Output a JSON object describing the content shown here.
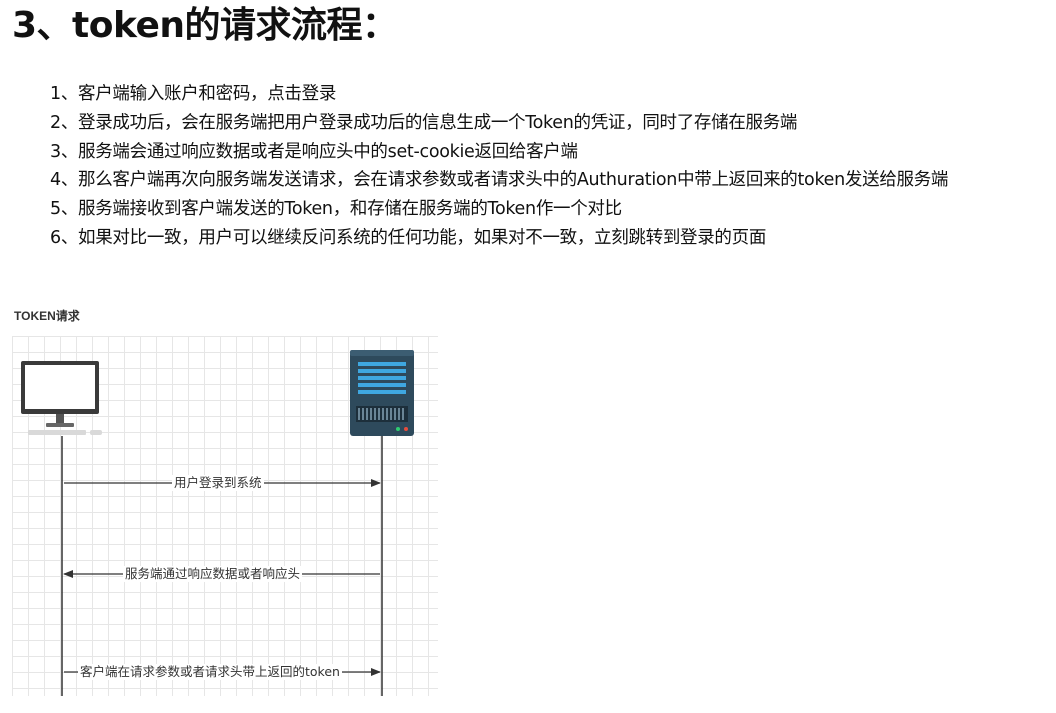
{
  "heading": "3、token的请求流程：",
  "steps": [
    "1、客户端输入账户和密码，点击登录",
    "2、登录成功后，会在服务端把用户登录成功后的信息生成一个Token的凭证，同时了存储在服务端",
    "3、服务端会通过响应数据或者是响应头中的set-cookie返回给客户端",
    "4、那么客户端再次向服务端发送请求，会在请求参数或者请求头中的Authuration中带上返回来的token发送给服务端",
    "5、服务端接收到客户端发送的Token，和存储在服务端的Token作一个对比",
    "6、如果对比一致，用户可以继续反问系统的任何功能，如果对不一致，立刻跳转到登录的页面"
  ],
  "diagram": {
    "title": "TOKEN请求",
    "client_icon": "desktop-computer-icon",
    "server_icon": "server-rack-icon",
    "messages": [
      {
        "label": "用户登录到系统",
        "direction": "client-to-server"
      },
      {
        "label": "服务端通过响应数据或者响应头",
        "direction": "server-to-client"
      },
      {
        "label": "客户端在请求参数或者请求头带上返回的token",
        "direction": "client-to-server"
      }
    ]
  },
  "colors": {
    "server_body": "#2e4a5c",
    "server_accent": "#3fa7e0",
    "monitor_frame": "#3a3a3a",
    "line": "#333333",
    "grid": "#e6e6e6"
  }
}
